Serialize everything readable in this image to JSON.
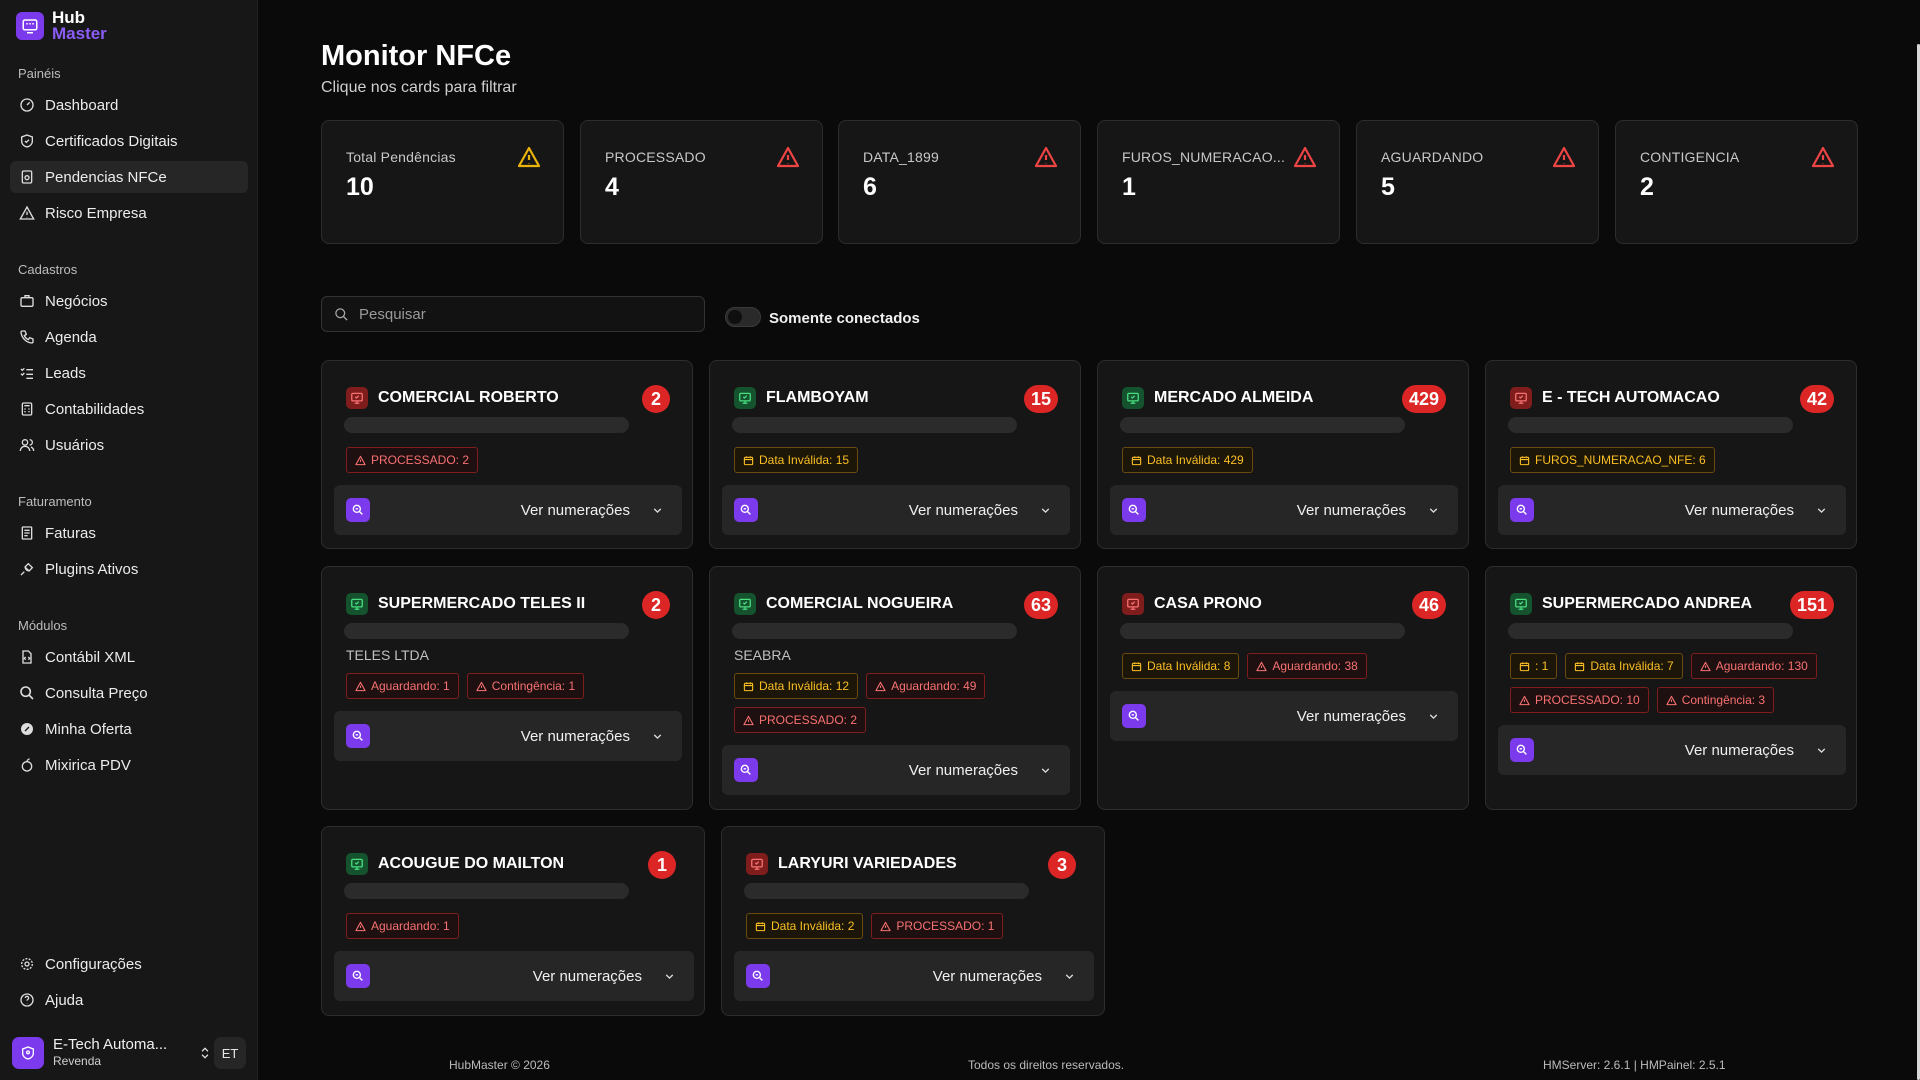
{
  "app": {
    "logo_line1": "Hub",
    "logo_line2": "Master"
  },
  "sidebar": {
    "sections": [
      {
        "label": "Painéis",
        "items": [
          {
            "label": "Dashboard",
            "icon": "gauge-icon"
          },
          {
            "label": "Certificados Digitais",
            "icon": "shield-check-icon"
          },
          {
            "label": "Pendencias NFCe",
            "icon": "receipt-icon",
            "active": true
          },
          {
            "label": "Risco Empresa",
            "icon": "warning-icon"
          }
        ]
      },
      {
        "label": "Cadastros",
        "items": [
          {
            "label": "Negócios",
            "icon": "briefcase-icon"
          },
          {
            "label": "Agenda",
            "icon": "phone-icon"
          },
          {
            "label": "Leads",
            "icon": "list-checks-icon"
          },
          {
            "label": "Contabilidades",
            "icon": "calculator-icon"
          },
          {
            "label": "Usuários",
            "icon": "users-icon"
          }
        ]
      },
      {
        "label": "Faturamento",
        "items": [
          {
            "label": "Faturas",
            "icon": "invoice-icon"
          },
          {
            "label": "Plugins Ativos",
            "icon": "plug-icon"
          }
        ]
      },
      {
        "label": "Módulos",
        "items": [
          {
            "label": "Contábil XML",
            "icon": "file-code-icon"
          },
          {
            "label": "Consulta Preço",
            "icon": "search-dollar-icon"
          },
          {
            "label": "Minha Oferta",
            "icon": "badge-percent-icon"
          },
          {
            "label": "Mixirica PDV",
            "icon": "citrus-icon"
          }
        ]
      }
    ],
    "bottom_items": [
      {
        "label": "Configurações",
        "icon": "gear-icon"
      },
      {
        "label": "Ajuda",
        "icon": "help-icon"
      }
    ],
    "user": {
      "name": "E-Tech Automa...",
      "role": "Revenda",
      "initials": "ET"
    }
  },
  "header": {
    "title": "Monitor NFCe",
    "subtitle": "Clique nos cards para filtrar"
  },
  "stats": [
    {
      "label": "Total Pendências",
      "value": "10",
      "icon_color": "#eab308"
    },
    {
      "label": "PROCESSADO",
      "value": "4",
      "icon_color": "#ef4444"
    },
    {
      "label": "DATA_1899",
      "value": "6",
      "icon_color": "#ef4444"
    },
    {
      "label": "FUROS_NUMERACAO...",
      "value": "1",
      "icon_color": "#ef4444"
    },
    {
      "label": "AGUARDANDO",
      "value": "5",
      "icon_color": "#ef4444"
    },
    {
      "label": "CONTIGENCIA",
      "value": "2",
      "icon_color": "#ef4444"
    }
  ],
  "search": {
    "placeholder": "Pesquisar"
  },
  "filter": {
    "label": "Somente conectados",
    "on": false
  },
  "cards": [
    {
      "name": "COMERCIAL ROBERTO",
      "count": "2",
      "status": "red",
      "sub": "",
      "tags": [
        {
          "text": "PROCESSADO: 2",
          "kind": "red"
        }
      ],
      "button": "Ver numerações"
    },
    {
      "name": "FLAMBOYAM",
      "count": "15",
      "status": "green",
      "sub": "",
      "tags": [
        {
          "text": "Data Inválida: 15",
          "kind": "amber"
        }
      ],
      "button": "Ver numerações"
    },
    {
      "name": "MERCADO ALMEIDA",
      "count": "429",
      "status": "green",
      "sub": "",
      "tags": [
        {
          "text": "Data Inválida: 429",
          "kind": "amber"
        }
      ],
      "button": "Ver numerações"
    },
    {
      "name": "E - TECH AUTOMACAO",
      "count": "42",
      "status": "red",
      "sub": "",
      "tags": [
        {
          "text": "FUROS_NUMERACAO_NFE: 6",
          "kind": "amber"
        }
      ],
      "button": "Ver numerações"
    },
    {
      "name": "SUPERMERCADO TELES II",
      "count": "2",
      "status": "green",
      "sub": "TELES LTDA",
      "tags": [
        {
          "text": "Aguardando: 1",
          "kind": "red"
        },
        {
          "text": "Contingência: 1",
          "kind": "red"
        }
      ],
      "button": "Ver numerações"
    },
    {
      "name": "COMERCIAL NOGUEIRA",
      "count": "63",
      "status": "green",
      "sub": "SEABRA",
      "tags": [
        {
          "text": "Data Inválida: 12",
          "kind": "amber"
        },
        {
          "text": "Aguardando: 49",
          "kind": "red"
        },
        {
          "text": "PROCESSADO: 2",
          "kind": "red"
        }
      ],
      "button": "Ver numerações"
    },
    {
      "name": "CASA PRONO",
      "count": "46",
      "status": "red",
      "sub": "",
      "tags": [
        {
          "text": "Data Inválida: 8",
          "kind": "amber"
        },
        {
          "text": "Aguardando: 38",
          "kind": "red"
        }
      ],
      "button": "Ver numerações"
    },
    {
      "name": "SUPERMERCADO ANDREA",
      "count": "151",
      "status": "green",
      "sub": "",
      "tags": [
        {
          "text": ": 1",
          "kind": "amber"
        },
        {
          "text": "Data Inválida: 7",
          "kind": "amber"
        },
        {
          "text": "Aguardando: 130",
          "kind": "red"
        },
        {
          "text": "PROCESSADO: 10",
          "kind": "red"
        },
        {
          "text": "Contingência: 3",
          "kind": "red"
        }
      ],
      "button": "Ver numerações"
    },
    {
      "name": "ACOUGUE DO MAILTON",
      "count": "1",
      "status": "green",
      "sub": "",
      "tags": [
        {
          "text": "Aguardando: 1",
          "kind": "red"
        }
      ],
      "button": "Ver numerações"
    },
    {
      "name": "LARYURI VARIEDADES",
      "count": "3",
      "status": "red",
      "sub": "",
      "tags": [
        {
          "text": "Data Inválida: 2",
          "kind": "amber"
        },
        {
          "text": "PROCESSADO: 1",
          "kind": "red"
        }
      ],
      "button": "Ver numerações"
    }
  ],
  "footer": {
    "left": "HubMaster © 2026",
    "center": "Todos os direitos reservados.",
    "right": "HMServer: 2.6.1 | HMPainel: 2.5.1"
  }
}
